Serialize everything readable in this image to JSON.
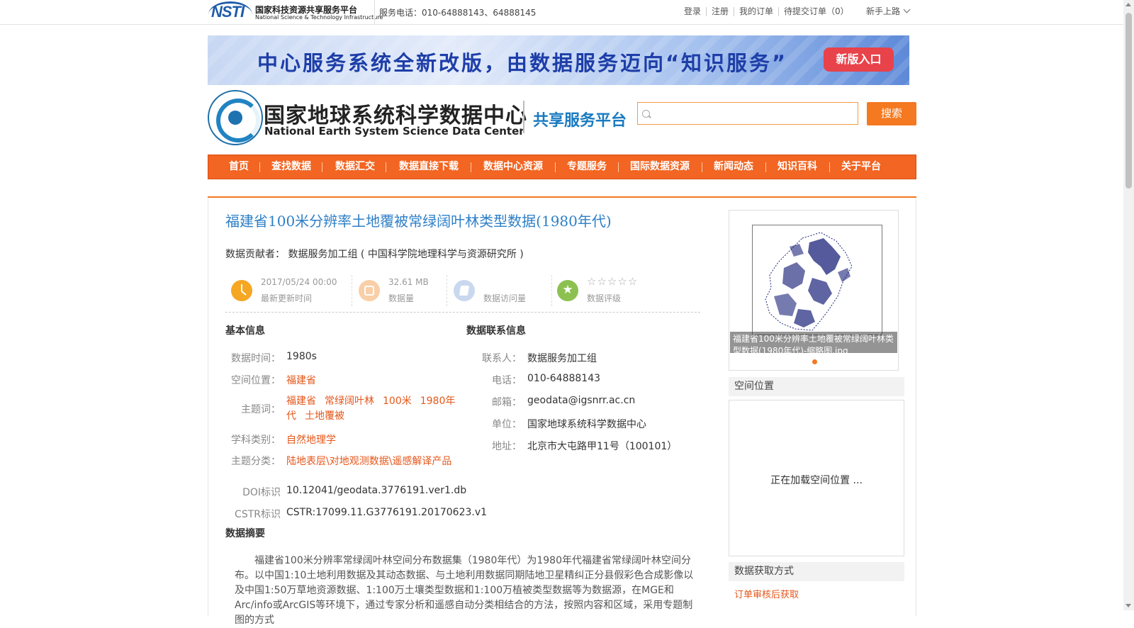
{
  "topbar": {
    "logo_brand": "NSTI",
    "logo_cn": "国家科技资源共享服务平台",
    "logo_en": "National Science & Technology Infrastructure",
    "phone": "服务电话：010-64888143、64888145",
    "links": [
      "登录",
      "注册",
      "我的订单",
      "待提交订单（0）"
    ],
    "guide": "新手上路"
  },
  "banner": {
    "text": "中心服务系统全新改版，由数据服务迈向“知识服务”",
    "button": "新版入口"
  },
  "header": {
    "title_cn": "国家地球系统科学数据中心",
    "title_en": "National Earth System Science Data Center",
    "subtitle": "共享服务平台",
    "search_value": "",
    "search_button": "搜索"
  },
  "nav": [
    "首页",
    "查找数据",
    "数据汇交",
    "数据直接下载",
    "数据中心资源",
    "专题服务",
    "国际数据资源",
    "新闻动态",
    "知识百科",
    "关于平台"
  ],
  "dataset": {
    "title": "福建省100米分辨率土地覆被常绿阔叶林类型数据(1980年代)",
    "contributor_label": "数据贡献者：",
    "contributor": "数据服务加工组 ( 中国科学院地理科学与资源研究所 )",
    "stats": {
      "update_time": "2017/05/24 00:00",
      "update_label": "最新更新时间",
      "size": "32.61 MB",
      "size_label": "数据量",
      "visits_label": "数据访问量",
      "rating_stars": "☆☆☆☆☆",
      "rating_label": "数据评级"
    }
  },
  "basic_info": {
    "heading": "基本信息",
    "time_label": "数据时间：",
    "time": "1980s",
    "location_label": "空间位置：",
    "location": "福建省",
    "keywords_label": "主题词：",
    "keywords": [
      "福建省",
      "常绿阔叶林",
      "100米",
      "1980年代",
      "土地覆被"
    ],
    "discipline_label": "学科类别：",
    "discipline": "自然地理学",
    "category_label": "主题分类：",
    "category": "陆地表层\\对地观测数据\\遥感解译产品",
    "doi_label": "DOI标识",
    "doi": "10.12041/geodata.3776191.ver1.db",
    "cstr_label": "CSTR标识",
    "cstr": "CSTR:17099.11.G3776191.20170623.v1"
  },
  "contact_info": {
    "heading": "数据联系信息",
    "contact_label": "联系人：",
    "contact": "数据服务加工组",
    "phone_label": "电话：",
    "phone": "010-64888143",
    "email_label": "邮箱：",
    "email": "geodata@igsnrr.ac.cn",
    "unit_label": "单位：",
    "unit": "国家地球系统科学数据中心",
    "address_label": "地址：",
    "address": "北京市大屯路甲11号（100101）"
  },
  "abstract": {
    "heading": "数据摘要",
    "text": "福建省100米分辨率常绿阔叶林空间分布数据集（1980年代）为1980年代福建省常绿阔叶林空间分布。以中国1:10土地利用数据及其动态数据、与土地利用数据同期陆地卫星精纠正分县假彩色合成影像以及中国1:50万草地资源数据、1:100万土壤类型数据和1:100万植被类型数据等为数据源，在MGE和Arc/info或ArcGIS等环境下，通过专家分析和遥感自动分类相结合的方法，按照内容和区域，采用专题制图的方式"
  },
  "sidebar": {
    "thumbnail_caption": "福建省100米分辨率土地覆被常绿阔叶林类型数据(1980年代)-缩略图.jpg",
    "spatial_heading": "空间位置",
    "map_loading": "正在加载空间位置 ...",
    "access_heading": "数据获取方式",
    "access_link": "订单审核后获取"
  },
  "colors": {
    "accent_orange": "#f47920",
    "link_orange": "#e4571b",
    "title_blue": "#2d7fc7"
  }
}
